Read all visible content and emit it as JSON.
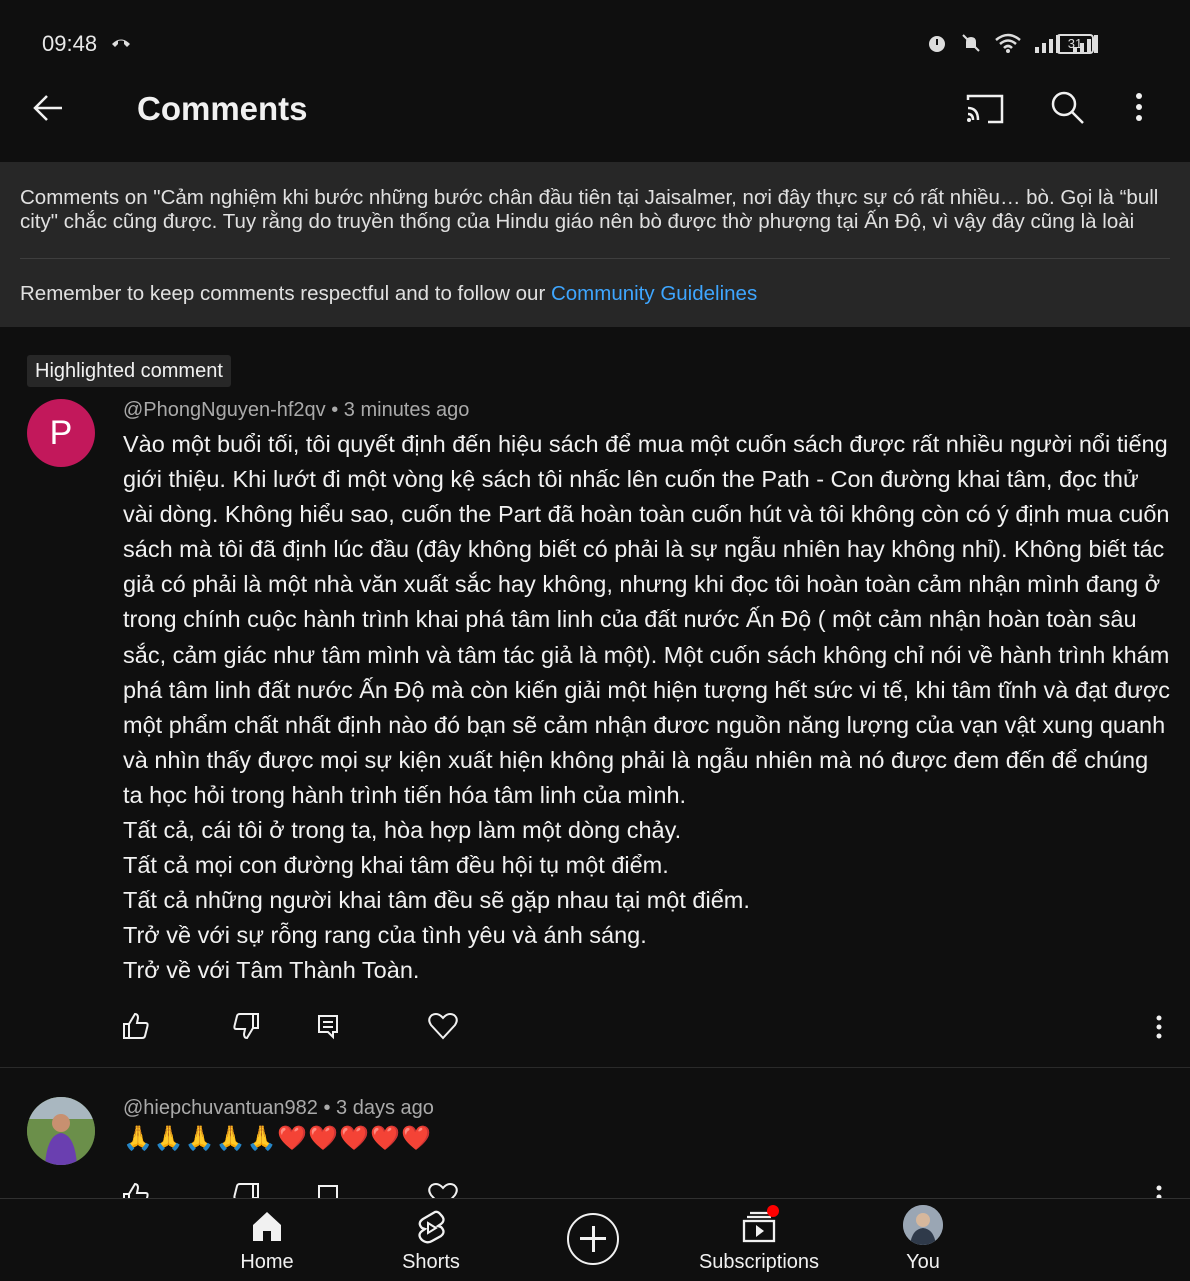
{
  "status_bar": {
    "time": "09:48",
    "battery": "31"
  },
  "app_bar": {
    "title": "Comments"
  },
  "info_panel": {
    "video_title_text": "Comments on \"Cảm nghiệm khi bước những bước chân đầu tiên tại Jaisalmer, nơi đây thực sự có rất nhiều… bò. Gọi là “bull city\" chắc cũng được. Tuy rằng do truyền thống của Hindu giáo nên bò được thờ phượng tại Ấn Độ, vì vậy đây cũng là loài độn…",
    "guidelines_prefix": "Remember to keep comments respectful and to follow our ",
    "guidelines_link": "Community Guidelines"
  },
  "highlighted_badge": "Highlighted comment",
  "comments": [
    {
      "avatar_letter": "P",
      "author": "@PhongNguyen-hf2qv",
      "time": "3 minutes ago",
      "text": "Vào một buổi tối, tôi quyết định đến hiệu sách để mua một cuốn sách được rất nhiều người nổi tiếng giới thiệu. Khi lướt đi một vòng kệ sách tôi nhấc lên cuốn the Path - Con đường khai tâm, đọc thử vài dòng. Không hiểu sao, cuốn the Part đã hoàn toàn cuốn hút và tôi không còn có ý định mua cuốn sách mà tôi đã định lúc đầu (đây không biết có phải là sự ngẫu nhiên hay không nhỉ). Không biết tác giả có phải là một nhà văn xuất sắc hay không, nhưng khi đọc tôi hoàn toàn cảm nhận mình đang ở trong chính cuộc hành trình khai phá tâm linh của đất nước Ấn Độ ( một cảm nhận hoàn toàn sâu sắc, cảm giác như tâm mình và tâm tác giả là một). Một cuốn sách không chỉ nói về hành trình khám phá tâm linh đất nước Ấn Độ mà còn kiến giải một hiện tượng hết sức vi tế, khi tâm tĩnh và đạt được một phẩm chất nhất định nào đó bạn sẽ cảm nhận đươc nguồn năng lượng của vạn vật xung quanh và nhìn thấy được mọi sự kiện xuất hiện không phải là ngẫu nhiên mà nó được đem đến để chúng ta học hỏi trong hành trình tiến hóa tâm linh của mình.\nTất cả, cái tôi ở trong ta, hòa hợp làm một dòng chảy.\nTất cả mọi con đường khai tâm đều hội tụ một điểm.\nTất cả những người khai tâm đều sẽ gặp nhau tại một điểm.\nTrở về với sự rỗng rang của tình yêu và ánh sáng.\nTrở về với Tâm Thành Toàn."
    },
    {
      "author": "@hiepchuvantuan982",
      "time": "3 days ago",
      "text": "🙏🙏🙏🙏🙏❤️❤️❤️❤️❤️"
    }
  ],
  "bottom_nav": {
    "home": "Home",
    "shorts": "Shorts",
    "subscriptions": "Subscriptions",
    "you": "You"
  },
  "colors": {
    "link": "#3ea6ff",
    "avatar_p": "#c2185b",
    "notification": "#ff0000"
  },
  "icons": [
    "back-arrow-icon",
    "cast-icon",
    "search-icon",
    "more-vert-icon",
    "thumb-up-icon",
    "thumb-down-icon",
    "reply-icon",
    "heart-icon",
    "home-icon",
    "shorts-icon",
    "create-icon",
    "subscriptions-icon"
  ]
}
